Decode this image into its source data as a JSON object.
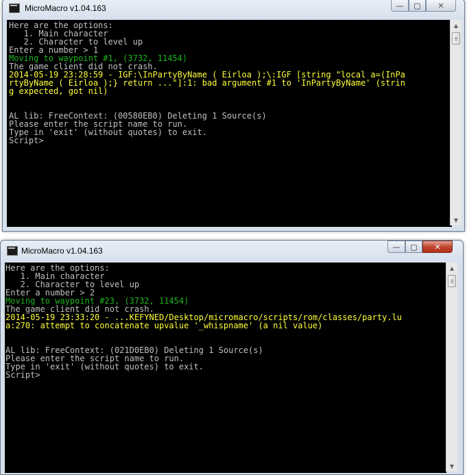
{
  "window1": {
    "title": "MicroMacro v1.04.163",
    "controls": {
      "minimize": "—",
      "maximize": "▢",
      "close": "✕"
    },
    "lines": [
      {
        "text": "Here are the options:",
        "color": "default"
      },
      {
        "text": "   1. Main character",
        "color": "default"
      },
      {
        "text": "   2. Character to level up",
        "color": "default"
      },
      {
        "text": "Enter a number > 1",
        "color": "default"
      },
      {
        "text": "Moving to waypoint #1, (3732, 11454)",
        "color": "green"
      },
      {
        "text": "The game client did not crash.",
        "color": "default"
      },
      {
        "text": "2014-05-19 23:28:59 - IGF:\\InPartyByName ( Eirloa );\\:IGF [string \"local a=(InPa",
        "color": "yellow"
      },
      {
        "text": "rtyByName ( Eirloa );} return ...\"]:1: bad argument #1 to 'InPartyByName' (strin",
        "color": "yellow"
      },
      {
        "text": "g expected, got nil)",
        "color": "yellow"
      },
      {
        "text": "",
        "color": "default"
      },
      {
        "text": "",
        "color": "default"
      },
      {
        "text": "AL lib: FreeContext: (00580EB0) Deleting 1 Source(s)",
        "color": "default"
      },
      {
        "text": "Please enter the script name to run.",
        "color": "default"
      },
      {
        "text": "Type in 'exit' (without quotes) to exit.",
        "color": "default"
      },
      {
        "text": "Script>",
        "color": "default"
      }
    ]
  },
  "window2": {
    "title": "MicroMacro v1.04.163",
    "controls": {
      "minimize": "—",
      "maximize": "▢",
      "close": "✕"
    },
    "lines": [
      {
        "text": "Here are the options:",
        "color": "default"
      },
      {
        "text": "   1. Main character",
        "color": "default"
      },
      {
        "text": "   2. Character to level up",
        "color": "default"
      },
      {
        "text": "Enter a number > 2",
        "color": "default"
      },
      {
        "text": "Moving to waypoint #23, (3732, 11454)",
        "color": "green"
      },
      {
        "text": "The game client did not crash.",
        "color": "default"
      },
      {
        "text": "2014-05-19 23:33:20 - ...KEFYNED/Desktop/micromacro/scripts/rom/classes/party.lu",
        "color": "yellow"
      },
      {
        "text": "a:270: attempt to concatenate upvalue '_whispname' (a nil value)",
        "color": "yellow"
      },
      {
        "text": "",
        "color": "default"
      },
      {
        "text": "",
        "color": "default"
      },
      {
        "text": "AL lib: FreeContext: (021D0EB0) Deleting 1 Source(s)",
        "color": "default"
      },
      {
        "text": "Please enter the script name to run.",
        "color": "default"
      },
      {
        "text": "Type in 'exit' (without quotes) to exit.",
        "color": "default"
      },
      {
        "text": "Script>",
        "color": "default"
      }
    ]
  },
  "colors": {
    "console_bg": "#000000",
    "console_text": "#c0c0c0",
    "green_text": "#1fb51f",
    "yellow_text": "#ffff3c"
  },
  "icons": {
    "app": "console-app-icon",
    "scroll_up": "scroll-up-arrow-icon",
    "scroll_down": "scroll-down-arrow-icon"
  }
}
